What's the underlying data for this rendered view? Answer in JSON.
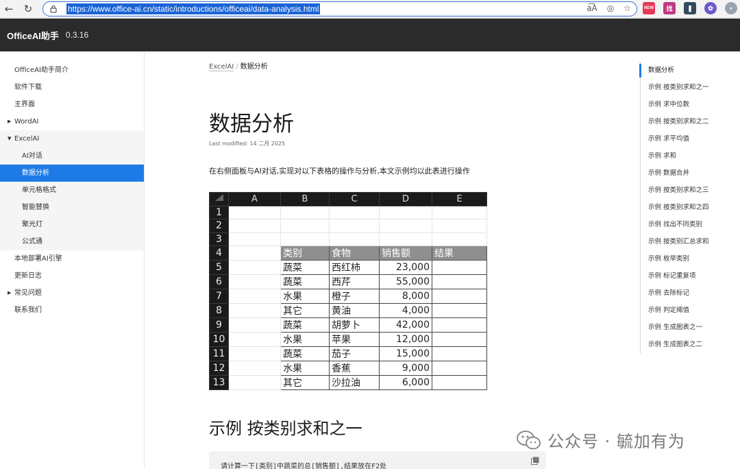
{
  "browser": {
    "url": "https://www.office-ai.cn/static/introductions/officeai/data-analysis.html",
    "new_badge": "NEW"
  },
  "header": {
    "title": "OfficeAI助手",
    "version": "0.3.16"
  },
  "sidebar": {
    "items": [
      {
        "label": "OfficeAI助手简介"
      },
      {
        "label": "软件下载"
      },
      {
        "label": "主界面"
      },
      {
        "label": "WordAI"
      },
      {
        "label": "ExcelAI"
      },
      {
        "label": "AI对话"
      },
      {
        "label": "数据分析"
      },
      {
        "label": "单元格格式"
      },
      {
        "label": "智能替换"
      },
      {
        "label": "聚光灯"
      },
      {
        "label": "公式通"
      },
      {
        "label": "本地部署AI引擎"
      },
      {
        "label": "更新日志"
      },
      {
        "label": "常见问题"
      },
      {
        "label": "联系我们"
      }
    ]
  },
  "main": {
    "breadcrumb_parent": "ExcelAI",
    "breadcrumb_sep": "/",
    "breadcrumb_current": "数据分析",
    "title": "数据分析",
    "modified": "Last modified: 14 二月 2025",
    "intro": "在右侧面板与AI对话,实现对以下表格的操作与分析,本文示例均以此表进行操作",
    "section_title": "示例 按类别求和之一",
    "code_text": "请计算一下[类别]中蔬菜的总[销售额],结果放在F2处"
  },
  "sheet": {
    "columns": [
      "A",
      "B",
      "C",
      "D",
      "E"
    ],
    "row_numbers": [
      "1",
      "2",
      "3",
      "4",
      "5",
      "6",
      "7",
      "8",
      "9",
      "10",
      "11",
      "12",
      "13"
    ],
    "headers": [
      "类别",
      "食物",
      "销售额",
      "结果"
    ],
    "rows": [
      [
        "蔬菜",
        "西红柿",
        "23,000",
        ""
      ],
      [
        "蔬菜",
        "西芹",
        "55,000",
        ""
      ],
      [
        "水果",
        "橙子",
        "8,000",
        ""
      ],
      [
        "其它",
        "黄油",
        "4,000",
        ""
      ],
      [
        "蔬菜",
        "胡萝卜",
        "42,000",
        ""
      ],
      [
        "水果",
        "苹果",
        "12,000",
        ""
      ],
      [
        "蔬菜",
        "茄子",
        "15,000",
        ""
      ],
      [
        "水果",
        "香蕉",
        "9,000",
        ""
      ],
      [
        "其它",
        "沙拉油",
        "6,000",
        ""
      ]
    ]
  },
  "toc": {
    "items": [
      {
        "label": "数据分析"
      },
      {
        "label": "示例 按类别求和之一"
      },
      {
        "label": "示例 求中位数"
      },
      {
        "label": "示例 按类别求和之二"
      },
      {
        "label": "示例 求平均值"
      },
      {
        "label": "示例 求和"
      },
      {
        "label": "示例 数据合并"
      },
      {
        "label": "示例 按类别求和之三"
      },
      {
        "label": "示例 按类别求和之四"
      },
      {
        "label": "示例 找出不同类别"
      },
      {
        "label": "示例 按类别汇总求和"
      },
      {
        "label": "示例 枚举类别"
      },
      {
        "label": "示例 标记重复项"
      },
      {
        "label": "示例 去除标记"
      },
      {
        "label": "示例 判定阈值"
      },
      {
        "label": "示例 生成图表之一"
      },
      {
        "label": "示例 生成图表之二"
      }
    ]
  },
  "watermark": {
    "text": "公众号 · 毓加有为"
  },
  "colors": {
    "accent": "#1e7be6",
    "header_bg": "#2b2b2b",
    "sheet_header_bg": "#1b1b1b"
  }
}
